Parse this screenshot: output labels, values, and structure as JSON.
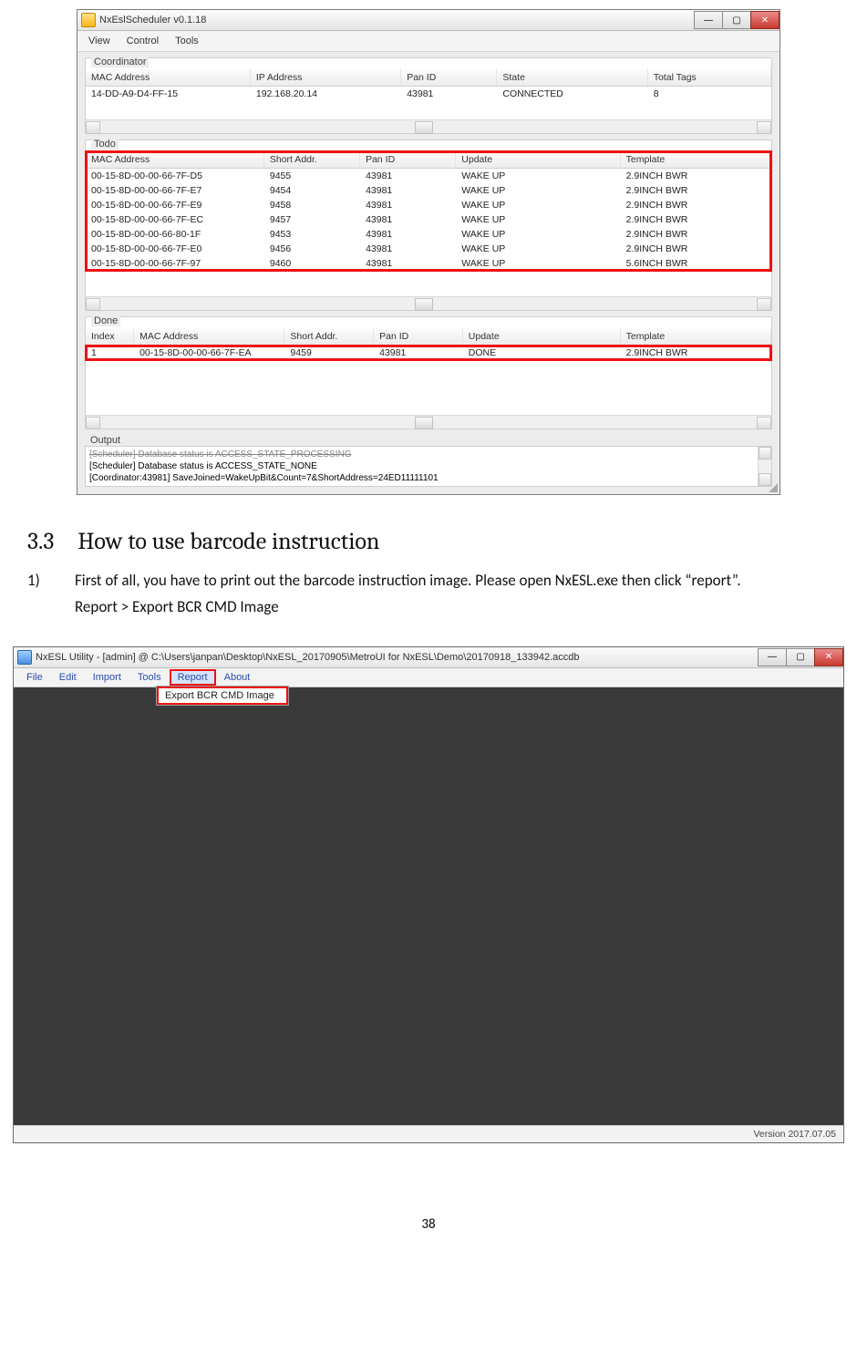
{
  "scheduler": {
    "title": "NxEslScheduler v0.1.18",
    "menu": [
      "View",
      "Control",
      "Tools"
    ],
    "coordinator": {
      "label": "Coordinator",
      "headers": [
        "MAC Address",
        "IP Address",
        "Pan ID",
        "State",
        "Total Tags"
      ],
      "rows": [
        {
          "mac": "14-DD-A9-D4-FF-15",
          "ip": "192.168.20.14",
          "pan": "43981",
          "state": "CONNECTED",
          "tags": "8"
        }
      ]
    },
    "todo": {
      "label": "Todo",
      "headers": [
        "MAC Address",
        "Short Addr.",
        "Pan ID",
        "Update",
        "Template"
      ],
      "rows": [
        {
          "mac": "00-15-8D-00-00-66-7F-D5",
          "short": "9455",
          "pan": "43981",
          "update": "WAKE UP",
          "tpl": "2.9INCH BWR"
        },
        {
          "mac": "00-15-8D-00-00-66-7F-E7",
          "short": "9454",
          "pan": "43981",
          "update": "WAKE UP",
          "tpl": "2.9INCH BWR"
        },
        {
          "mac": "00-15-8D-00-00-66-7F-E9",
          "short": "9458",
          "pan": "43981",
          "update": "WAKE UP",
          "tpl": "2.9INCH BWR"
        },
        {
          "mac": "00-15-8D-00-00-66-7F-EC",
          "short": "9457",
          "pan": "43981",
          "update": "WAKE UP",
          "tpl": "2.9INCH BWR"
        },
        {
          "mac": "00-15-8D-00-00-66-80-1F",
          "short": "9453",
          "pan": "43981",
          "update": "WAKE UP",
          "tpl": "2.9INCH BWR"
        },
        {
          "mac": "00-15-8D-00-00-66-7F-E0",
          "short": "9456",
          "pan": "43981",
          "update": "WAKE UP",
          "tpl": "2.9INCH BWR"
        },
        {
          "mac": "00-15-8D-00-00-66-7F-97",
          "short": "9460",
          "pan": "43981",
          "update": "WAKE UP",
          "tpl": "5.6INCH BWR"
        }
      ]
    },
    "done": {
      "label": "Done",
      "headers": [
        "Index",
        "MAC Address",
        "Short Addr.",
        "Pan ID",
        "Update",
        "Template"
      ],
      "rows": [
        {
          "idx": "1",
          "mac": "00-15-8D-00-00-66-7F-EA",
          "short": "9459",
          "pan": "43981",
          "update": "DONE",
          "tpl": "2.9INCH BWR"
        }
      ]
    },
    "output": {
      "label": "Output",
      "lines": [
        "[Scheduler] Database status is ACCESS_STATE_PROCESSING",
        "[Scheduler] Database status is ACCESS_STATE_NONE",
        "[Coordinator:43981] SaveJoined=WakeUpBit&Count=7&ShortAddress=24ED11111101"
      ]
    }
  },
  "doc": {
    "heading_num": "3.3",
    "heading_text": "How to use barcode instruction",
    "step_num": "1)",
    "step_line1": "First of all, you have to print out the barcode instruction image. Please open NxESL.exe then click “report”.",
    "step_line2": "Report > Export BCR CMD Image"
  },
  "utility": {
    "title": "NxESL Utility - [admin] @ C:\\Users\\janpan\\Desktop\\NxESL_20170905\\MetroUI for NxESL\\Demo\\20170918_133942.accdb",
    "menu": [
      "File",
      "Edit",
      "Import",
      "Tools",
      "Report",
      "About"
    ],
    "selected_menu_index": 4,
    "dropdown_item": "Export BCR CMD Image",
    "status": "Version 2017.07.05"
  },
  "page_number": "38"
}
